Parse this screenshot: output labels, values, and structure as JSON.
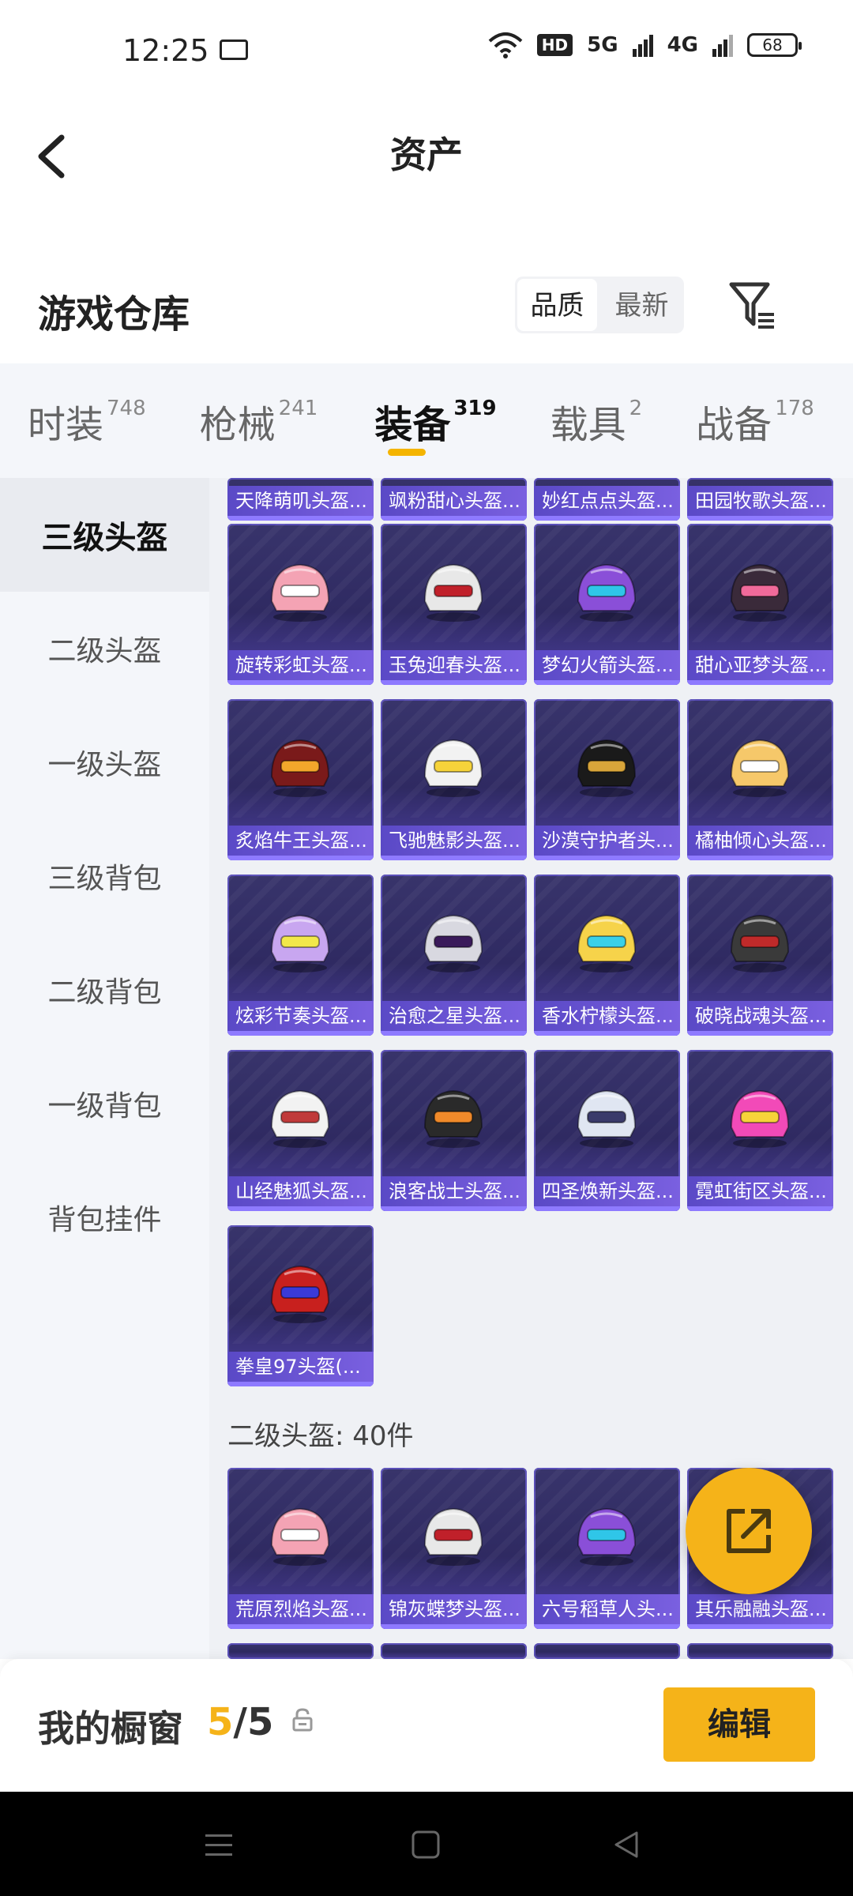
{
  "status_bar": {
    "time": "12:25",
    "hd_badge": "HD",
    "net1": "5G",
    "net2": "4G",
    "battery": "68"
  },
  "header": {
    "title": "资产"
  },
  "warehouse": {
    "title": "游戏仓库",
    "sort_options": [
      "品质",
      "最新"
    ],
    "active_sort": "品质"
  },
  "tabs": [
    {
      "label": "时装",
      "count": "748"
    },
    {
      "label": "枪械",
      "count": "241"
    },
    {
      "label": "装备",
      "count": "319"
    },
    {
      "label": "载具",
      "count": "2"
    },
    {
      "label": "战备",
      "count": "178"
    }
  ],
  "active_tab": "装备",
  "sidebar": {
    "items": [
      "三级头盔",
      "二级头盔",
      "一级头盔",
      "三级背包",
      "二级背包",
      "一级背包",
      "背包挂件"
    ],
    "active": "三级头盔"
  },
  "content": {
    "top_partial_row": [
      "天降萌叽头盔...",
      "飒粉甜心头盔...",
      "妙红点点头盔...",
      "田园牧歌头盔..."
    ],
    "level3_items": [
      "旋转彩虹头盔...",
      "玉兔迎春头盔...",
      "梦幻火箭头盔...",
      "甜心亚梦头盔...",
      "炙焰牛王头盔...",
      "飞驰魅影头盔...",
      "沙漠守护者头...",
      "橘柚倾心头盔...",
      "炫彩节奏头盔...",
      "治愈之星头盔...",
      "香水柠檬头盔...",
      "破晓战魂头盔...",
      "山经魅狐头盔...",
      "浪客战士头盔...",
      "四圣焕新头盔...",
      "霓虹街区头盔...",
      "拳皇97头盔(..."
    ],
    "level2_group_title": "二级头盔: 40件",
    "level2_items": [
      "荒原烈焰头盔...",
      "锦灰蝶梦头盔...",
      "六号稻草人头...",
      "其乐融融头盔..."
    ]
  },
  "showcase": {
    "label": "我的橱窗",
    "current": "5",
    "total": "5",
    "edit_label": "编辑"
  },
  "colors": {
    "accent": "#f5b319",
    "card_bg": "#2f2a62",
    "card_label": "#6a55d4"
  }
}
